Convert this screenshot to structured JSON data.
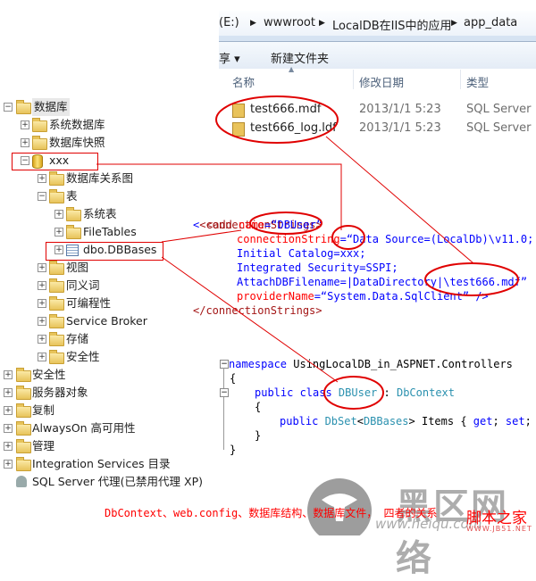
{
  "explorer": {
    "breadcrumb": [
      "(E:)",
      "wwwroot",
      "LocalDB在IIS中的应用",
      "app_data"
    ],
    "toolbar": {
      "share": "享 ▾",
      "new_folder": "新建文件夹"
    },
    "columns": [
      "名称",
      "修改日期",
      "类型"
    ],
    "files": [
      {
        "name": "test666.mdf",
        "date": "2013/1/1 5:23",
        "type": "SQL Server"
      },
      {
        "name": "test666_log.ldf",
        "date": "2013/1/1 5:23",
        "type": "SQL Server"
      }
    ]
  },
  "tree": [
    {
      "label": "数据库",
      "level": 0,
      "toggle": "−"
    },
    {
      "label": "系统数据库",
      "level": 1,
      "toggle": "+"
    },
    {
      "label": "数据库快照",
      "level": 1,
      "toggle": "+"
    },
    {
      "label": "xxx",
      "level": 1,
      "toggle": "−",
      "icon": "database"
    },
    {
      "label": "数据库关系图",
      "level": 2,
      "toggle": "+"
    },
    {
      "label": "表",
      "level": 2,
      "toggle": "−"
    },
    {
      "label": "系统表",
      "level": 3,
      "toggle": "+"
    },
    {
      "label": "FileTables",
      "level": 3,
      "toggle": "+"
    },
    {
      "label": "dbo.DBBases",
      "level": 3,
      "toggle": "+",
      "icon": "table"
    },
    {
      "label": "视图",
      "level": 2,
      "toggle": "+"
    },
    {
      "label": "同义词",
      "level": 2,
      "toggle": "+"
    },
    {
      "label": "可编程性",
      "level": 2,
      "toggle": "+"
    },
    {
      "label": "Service Broker",
      "level": 2,
      "toggle": "+"
    },
    {
      "label": "存储",
      "level": 2,
      "toggle": "+"
    },
    {
      "label": "安全性",
      "level": 2,
      "toggle": "+"
    },
    {
      "label": "安全性",
      "level": 0,
      "toggle": "+"
    },
    {
      "label": "服务器对象",
      "level": 0,
      "toggle": "+"
    },
    {
      "label": "复制",
      "level": 0,
      "toggle": "+"
    },
    {
      "label": "AlwaysOn 高可用性",
      "level": 0,
      "toggle": "+"
    },
    {
      "label": "管理",
      "level": 0,
      "toggle": "+"
    },
    {
      "label": "Integration Services 目录",
      "level": 0,
      "toggle": "+"
    },
    {
      "label": "SQL Server 代理(已禁用代理 XP)",
      "level": 0,
      "toggle": "",
      "icon": "agent"
    }
  ],
  "xml": {
    "l1": "<connectionStrings>",
    "l2a": "<add ",
    "l2b": "name",
    "l2c": "=“DBUser”",
    "l3a": "connectionString",
    "l3b": "=“Data Source=(LocalDb)\\v11.0;",
    "l4": "Initial Catalog=xxx;",
    "l5": "Integrated Security=SSPI;",
    "l6": "AttachDBFilename=|DataDirectory|\\test666.mdf”",
    "l7a": "providerName",
    "l7b": "=“System.Data.SqlClient”",
    "l7c": " />",
    "l8": "</connectionStrings>"
  },
  "csharp": {
    "ns_kw": "namespace",
    "ns_name": " UsingLocalDB_in_ASPNET.Controllers",
    "open": "{",
    "close": "}",
    "pub": "public class ",
    "cls": "DBUser",
    "colon": " : ",
    "base": "DbContext",
    "pub2": "public ",
    "dbset": "DbSet",
    "lt": "<",
    "ent": "DBBases",
    "gt": ">",
    "items": " Items { ",
    "get": "get",
    "semi": "; ",
    "set": "set",
    "end": "; }"
  },
  "caption": "DbContext、web.config、数据库结构、数据库文件， 四者的关系",
  "watermark": {
    "brand": "黑区网络",
    "url": "www.heiqu.com",
    "site": "脚本之家",
    "site_url": "WWW.JB51.NET"
  },
  "colors": {
    "highlight": "#e00000",
    "keyword": "#0000ff",
    "type": "#2b91af"
  }
}
